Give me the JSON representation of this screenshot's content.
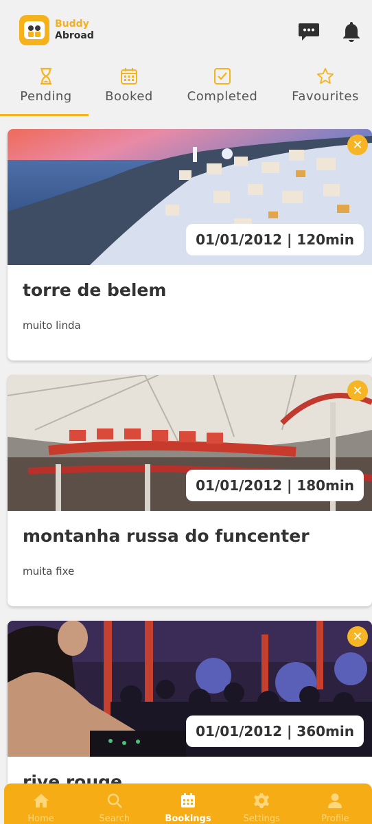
{
  "app": {
    "name_line1": "Buddy",
    "name_line2": "Abroad"
  },
  "colors": {
    "accent": "#f5b41c",
    "nav_bg": "#f6ac14",
    "bg": "#f1f1f1"
  },
  "header": {
    "icons": [
      "chat-icon",
      "bell-icon"
    ]
  },
  "tabs": [
    {
      "label": "Pending",
      "icon": "hourglass-icon",
      "active": true
    },
    {
      "label": "Booked",
      "icon": "calendar-icon",
      "active": false
    },
    {
      "label": "Completed",
      "icon": "check-square-icon",
      "active": false
    },
    {
      "label": "Favourites",
      "icon": "star-icon",
      "active": false
    }
  ],
  "bookings": [
    {
      "title": "torre de belem",
      "description": "muito linda",
      "date_duration": "01/01/2012 | 120min"
    },
    {
      "title": "montanha russa do funcenter",
      "description": "muita fixe",
      "date_duration": "01/01/2012 | 180min"
    },
    {
      "title": "rive rouge",
      "description": "",
      "date_duration": "01/01/2012 | 360min"
    }
  ],
  "close_glyph": "✕",
  "bottom_nav": [
    {
      "label": "Home",
      "icon": "home-icon",
      "active": false
    },
    {
      "label": "Search",
      "icon": "search-icon",
      "active": false
    },
    {
      "label": "Bookings",
      "icon": "calendar-icon",
      "active": true
    },
    {
      "label": "Settings",
      "icon": "gear-icon",
      "active": false
    },
    {
      "label": "Profile",
      "icon": "user-icon",
      "active": false
    }
  ]
}
